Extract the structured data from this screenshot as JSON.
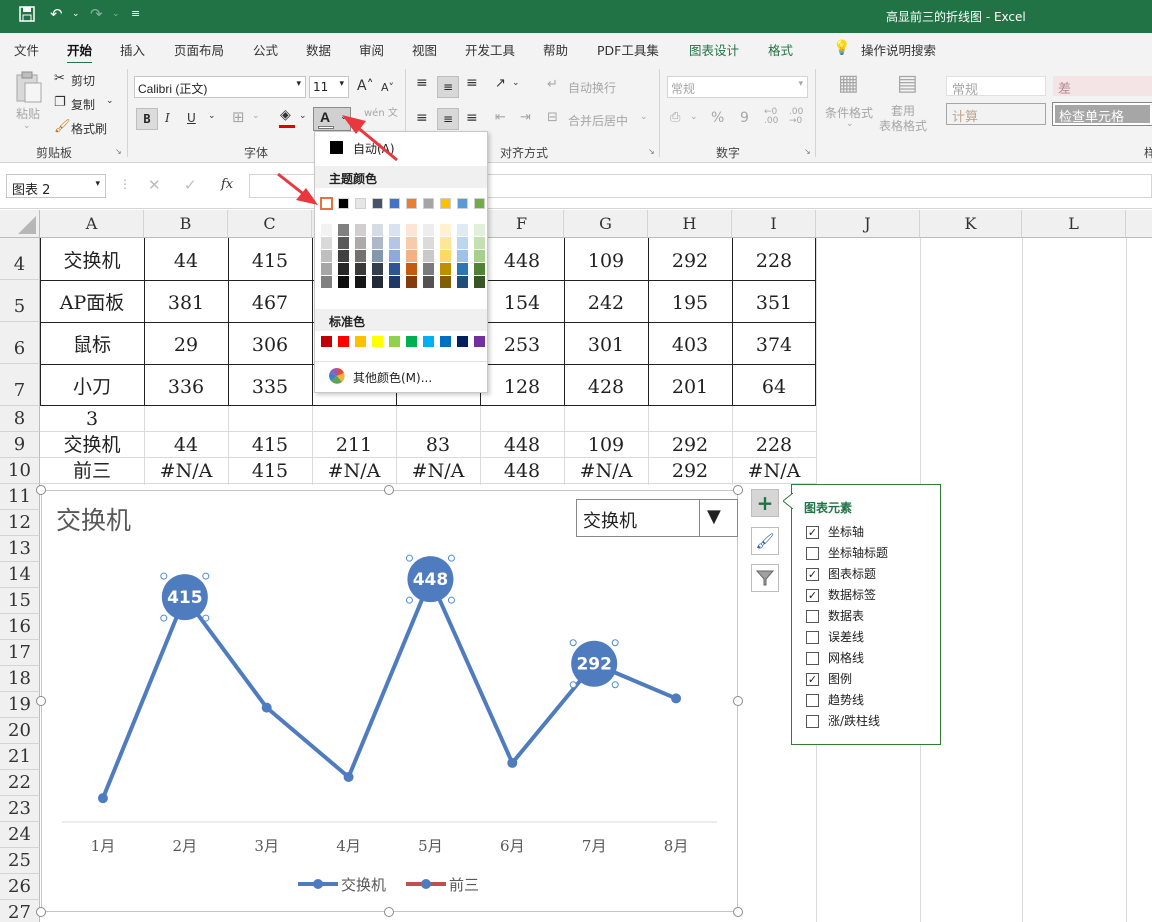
{
  "window": {
    "title": "高显前三的折线图 - Excel"
  },
  "ribbon_tabs": [
    "文件",
    "开始",
    "插入",
    "页面布局",
    "公式",
    "数据",
    "审阅",
    "视图",
    "开发工具",
    "帮助",
    "PDF工具集",
    "图表设计",
    "格式"
  ],
  "active_tab": "开始",
  "tell_me": "操作说明搜索",
  "clipboard": {
    "paste": "粘贴",
    "cut": "剪切",
    "copy": "复制",
    "format_painter": "格式刷",
    "label": "剪贴板"
  },
  "font": {
    "name": "Calibri (正文)",
    "size": "11",
    "bold": "B",
    "italic": "I",
    "underline": "U",
    "label": "字体",
    "wen": "wén 文"
  },
  "alignment": {
    "wrap": "自动换行",
    "merge": "合并后居中",
    "label": "对齐方式"
  },
  "number": {
    "format": "常规",
    "percent": "%",
    "comma": "9",
    "label": "数字"
  },
  "styles": {
    "conditional": "条件格式",
    "table_format": "套用\n表格格式",
    "normal": "常规",
    "bad": "差",
    "calc": "计算",
    "check": "检查单元格"
  },
  "formula_bar": {
    "name_box": "图表 2",
    "fx": "fx"
  },
  "color_popup": {
    "automatic": "自动(A)",
    "theme_title": "主题颜色",
    "standard_title": "标准色",
    "more": "其他颜色(M)...",
    "theme_colors": [
      "#FFFFFF",
      "#000000",
      "#E7E6E6",
      "#44546A",
      "#4472C4",
      "#ED7D31",
      "#A5A5A5",
      "#FFC000",
      "#5B9BD5",
      "#70AD47"
    ],
    "theme_shades": [
      [
        "#F2F2F2",
        "#D9D9D9",
        "#BFBFBF",
        "#A6A6A6",
        "#808080"
      ],
      [
        "#808080",
        "#595959",
        "#404040",
        "#262626",
        "#0D0D0D"
      ],
      [
        "#D0CECE",
        "#AEAAAA",
        "#757171",
        "#3B3838",
        "#171616"
      ],
      [
        "#D6DCE4",
        "#ADB9CA",
        "#8497B0",
        "#333F4F",
        "#222A35"
      ],
      [
        "#D9E2F3",
        "#B4C6E7",
        "#8EAADB",
        "#2F5496",
        "#1F3864"
      ],
      [
        "#FBE5D5",
        "#F7CBAC",
        "#F4B183",
        "#C55A11",
        "#843C0C"
      ],
      [
        "#EDEDED",
        "#DBDBDB",
        "#C9C9C9",
        "#7B7B7B",
        "#525252"
      ],
      [
        "#FFF2CC",
        "#FFE699",
        "#FFD966",
        "#BF8F00",
        "#7F6000"
      ],
      [
        "#DEEBF6",
        "#BDD7EE",
        "#9DC3E6",
        "#2E75B5",
        "#1F4E79"
      ],
      [
        "#E2EFD9",
        "#C5E0B3",
        "#A8D08D",
        "#538135",
        "#375623"
      ]
    ],
    "standard_colors": [
      "#C00000",
      "#FF0000",
      "#FFC000",
      "#FFFF00",
      "#92D050",
      "#00B050",
      "#00B0F0",
      "#0070C0",
      "#002060",
      "#7030A0"
    ]
  },
  "columns": [
    "A",
    "B",
    "C",
    "D",
    "E",
    "F",
    "G",
    "H",
    "I",
    "J",
    "K",
    "L"
  ],
  "rows": [
    {
      "num": "4",
      "cells": [
        "交换机",
        "44",
        "415",
        "",
        "",
        "448",
        "109",
        "292",
        "228"
      ]
    },
    {
      "num": "5",
      "cells": [
        "AP面板",
        "381",
        "467",
        "",
        "",
        "154",
        "242",
        "195",
        "351"
      ]
    },
    {
      "num": "6",
      "cells": [
        "鼠标",
        "29",
        "306",
        "",
        "",
        "253",
        "301",
        "403",
        "374"
      ]
    },
    {
      "num": "7",
      "cells": [
        "小刀",
        "336",
        "335",
        "",
        "",
        "128",
        "428",
        "201",
        "64"
      ]
    },
    {
      "num": "8",
      "cells": [
        "3",
        "",
        "",
        "",
        "",
        "",
        "",
        "",
        ""
      ]
    },
    {
      "num": "9",
      "cells": [
        "交换机",
        "44",
        "415",
        "211",
        "83",
        "448",
        "109",
        "292",
        "228"
      ]
    },
    {
      "num": "10",
      "cells": [
        "前三",
        "#N/A",
        "415",
        "#N/A",
        "#N/A",
        "448",
        "#N/A",
        "292",
        "#N/A"
      ]
    }
  ],
  "more_rows": [
    "11",
    "12",
    "13",
    "14",
    "15",
    "16",
    "17",
    "18",
    "19",
    "20",
    "21",
    "22",
    "23",
    "24",
    "25",
    "26",
    "27"
  ],
  "chart_data": {
    "type": "line",
    "title": "交换机",
    "dropdown_value": "交换机",
    "categories": [
      "1月",
      "2月",
      "3月",
      "4月",
      "5月",
      "6月",
      "7月",
      "8月"
    ],
    "series": [
      {
        "name": "交换机",
        "values": [
          44,
          415,
          211,
          83,
          448,
          109,
          292,
          228
        ],
        "color": "#4F7CBE"
      },
      {
        "name": "前三",
        "values": [
          null,
          415,
          null,
          null,
          448,
          null,
          292,
          null
        ],
        "color": "#C0504D"
      }
    ],
    "data_labels": [
      "415",
      "448",
      "292"
    ],
    "ylim": [
      0,
      500
    ],
    "grid": false,
    "legend": "bottom"
  },
  "chart_elements": {
    "title": "图表元素",
    "items": [
      {
        "label": "坐标轴",
        "checked": true
      },
      {
        "label": "坐标轴标题",
        "checked": false
      },
      {
        "label": "图表标题",
        "checked": true
      },
      {
        "label": "数据标签",
        "checked": true
      },
      {
        "label": "数据表",
        "checked": false
      },
      {
        "label": "误差线",
        "checked": false
      },
      {
        "label": "网格线",
        "checked": false
      },
      {
        "label": "图例",
        "checked": true
      },
      {
        "label": "趋势线",
        "checked": false
      },
      {
        "label": "涨/跌柱线",
        "checked": false
      }
    ]
  },
  "colors": {
    "excel_green": "#217346",
    "arrow_red": "#E8383D"
  }
}
